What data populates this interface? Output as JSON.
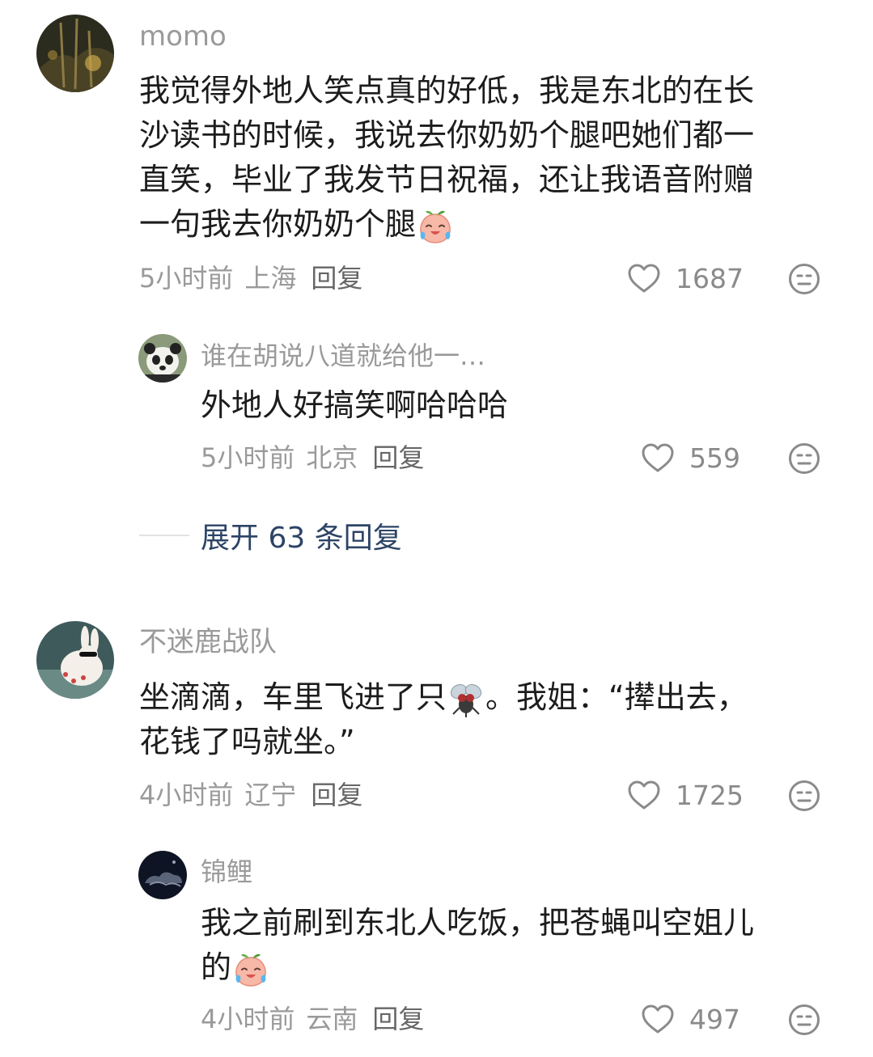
{
  "comments": [
    {
      "username": "momo",
      "avatar": "night-tree-avatar",
      "lines": [
        "我觉得外地人笑点真的好低，我是东北的在长",
        "沙读书的时候，我说去你奶奶个腿吧她们都一",
        "直笑，毕业了我发节日祝福，还让我语音附赠",
        "一句我去你奶奶个腿"
      ],
      "emoji": "crying-laughing-peach-emoji",
      "time": "5小时前",
      "location": "上海",
      "reply_label": "回复",
      "likes": "1687",
      "replies": [
        {
          "username": "谁在胡说八道就给他一…",
          "avatar": "panda-avatar",
          "lines": [
            "外地人好搞笑啊哈哈哈"
          ],
          "time": "5小时前",
          "location": "北京",
          "reply_label": "回复",
          "likes": "559"
        }
      ],
      "expand_label": "展开 63 条回复"
    },
    {
      "username": "不迷鹿战队",
      "avatar": "sunglasses-rabbit-avatar",
      "line1_before": "坐滴滴，车里飞进了只",
      "line1_after": "。我姐：“撵出去，",
      "line2": "花钱了吗就坐。”",
      "emoji": "fly-emoji",
      "time": "4小时前",
      "location": "辽宁",
      "reply_label": "回复",
      "likes": "1725",
      "replies": [
        {
          "username": "锦鲤",
          "avatar": "dark-cloud-avatar",
          "line1": "我之前刷到东北人吃饭，把苍蝇叫空姐儿",
          "line2": "的",
          "emoji": "crying-laughing-peach-emoji",
          "time": "4小时前",
          "location": "云南",
          "reply_label": "回复",
          "likes": "497"
        }
      ]
    }
  ],
  "colors": {
    "username": "#9a9a9a",
    "body": "#1c1c1c",
    "meta": "#9a9a9a",
    "expand": "#2d4466",
    "icon": "#8a8a8a"
  }
}
